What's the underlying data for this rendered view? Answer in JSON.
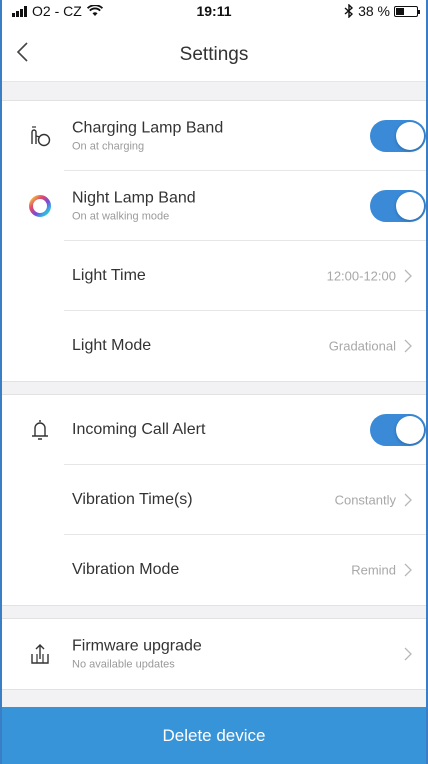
{
  "status_bar": {
    "carrier": "O2 - CZ",
    "time": "19:11",
    "battery_percent": "38 %",
    "battery_level": 0.38
  },
  "nav": {
    "title": "Settings"
  },
  "colors": {
    "accent": "#3a8ad8",
    "button": "#3794d8"
  },
  "lamp_group": {
    "charging": {
      "title": "Charging Lamp Band",
      "subtitle": "On at charging",
      "on": true,
      "icon": "cable-plug-icon"
    },
    "night": {
      "title": "Night Lamp Band",
      "subtitle": "On at walking mode",
      "on": true,
      "icon": "color-ring-icon"
    },
    "light_time": {
      "title": "Light Time",
      "value": "12:00-12:00"
    },
    "light_mode": {
      "title": "Light Mode",
      "value": "Gradational"
    }
  },
  "call_group": {
    "alert": {
      "title": "Incoming Call Alert",
      "on": true,
      "icon": "bell-icon"
    },
    "vibration_time": {
      "title": "Vibration Time(s)",
      "value": "Constantly"
    },
    "vibration_mode": {
      "title": "Vibration Mode",
      "value": "Remind"
    }
  },
  "firmware": {
    "title": "Firmware upgrade",
    "subtitle": "No available updates",
    "icon": "upload-icon"
  },
  "footer": {
    "delete_label": "Delete device"
  }
}
